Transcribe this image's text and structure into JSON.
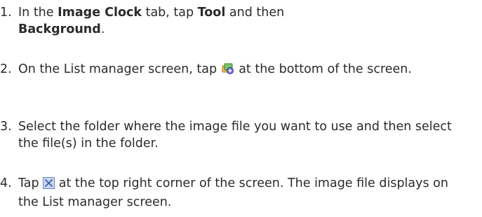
{
  "steps": [
    {
      "number": "1.",
      "parts": [
        "In the ",
        "Image Clock",
        " tab, tap ",
        "Tool",
        " and then ",
        "Background",
        "."
      ]
    },
    {
      "number": "2.",
      "parts": [
        "On the List manager screen, tap ",
        " at the bottom of the screen."
      ],
      "icon": "add-images-icon"
    },
    {
      "number": "3.",
      "text": "Select the folder where the image file you want to use and then select the file(s) in the folder."
    },
    {
      "number": "4.",
      "parts": [
        "Tap ",
        " at the top right corner of the screen. The image file displays on the List manager screen."
      ],
      "icon": "close-box-icon"
    }
  ]
}
